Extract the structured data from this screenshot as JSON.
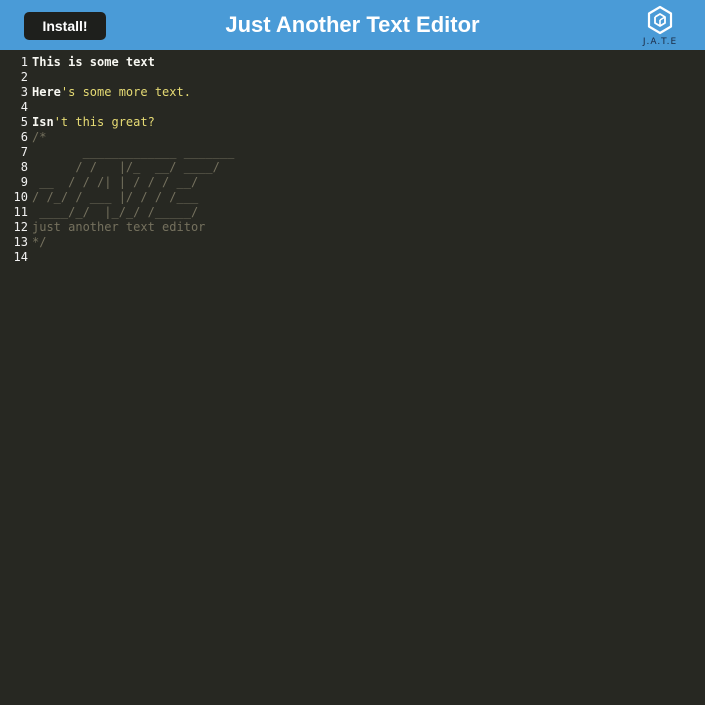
{
  "navbar": {
    "install_label": "Install!",
    "title": "Just Another Text Editor",
    "logo_text": "J.A.T.E",
    "logo_icon": "cube-icon",
    "background": "#4a9bd7"
  },
  "editor": {
    "background": "#272822",
    "line_numbers": [
      "1",
      "2",
      "3",
      "4",
      "5",
      "6",
      "7",
      "8",
      "9",
      "10",
      "11",
      "12",
      "13",
      "14"
    ],
    "lines": [
      {
        "plain": "This is some text",
        "str": ""
      },
      {
        "plain": "",
        "str": ""
      },
      {
        "plain": "Here",
        "str": "'s some more text."
      },
      {
        "plain": "",
        "str": ""
      },
      {
        "plain": "Isn",
        "str": "'t this great?"
      },
      {
        "comment": "/*"
      },
      {
        "comment": "       _____________ _______"
      },
      {
        "comment": "      / /   |/_  __/ ____/"
      },
      {
        "comment": " __  / / /| | / / / __/"
      },
      {
        "comment": "/ /_/ / ___ |/ / / /___"
      },
      {
        "comment": " ____/_/  |_/_/ /_____/"
      },
      {
        "comment": "just another text editor"
      },
      {
        "comment": "*/"
      },
      {
        "comment": ""
      }
    ]
  }
}
